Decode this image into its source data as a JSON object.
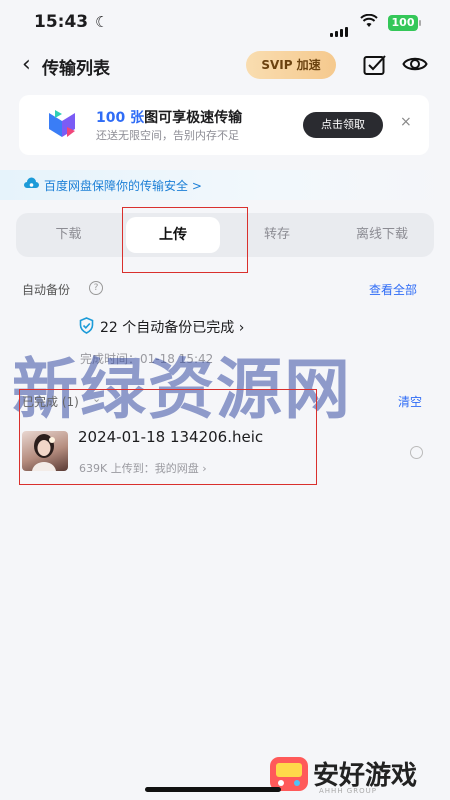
{
  "status_bar": {
    "time": "15:43",
    "battery": "100"
  },
  "header": {
    "title": "传输列表",
    "svip_label": "SVIP 加速"
  },
  "promo": {
    "title_highlight": "100 张",
    "title_rest": "图可享极速传输",
    "subtitle": "还送无限空间，告别内存不足",
    "button": "点击领取",
    "close": "×"
  },
  "security_notice": "百度网盘保障你的传输安全 >",
  "tabs": [
    {
      "label": "下载"
    },
    {
      "label": "上传"
    },
    {
      "label": "转存"
    },
    {
      "label": "离线下载"
    }
  ],
  "auto_backup": {
    "label": "自动备份",
    "view_all": "查看全部",
    "status": "22 个自动备份已完成 ›",
    "time": "完成时间：01-18 15:42"
  },
  "watermark": "新绿资源网",
  "completed": {
    "label": "已完成 (1)",
    "clear": "清空",
    "files": [
      {
        "name": "2024-01-18 134206.heic",
        "meta": "639K  上传到：我的网盘 ›"
      }
    ]
  },
  "brand": {
    "name": "安好游戏",
    "sub": "AHHH GROUP"
  },
  "colors": {
    "accent": "#2f6cf6",
    "highlight_border": "#d9302d",
    "battery": "#34c759"
  }
}
